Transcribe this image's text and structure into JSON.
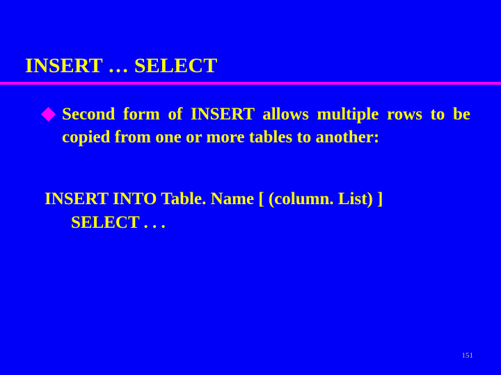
{
  "slide": {
    "title": "INSERT … SELECT",
    "bullet": "Second form of INSERT allows multiple rows to be copied from one or more tables to another:",
    "code": {
      "line1": "INSERT INTO Table. Name [ (column. List) ]",
      "line2": "SELECT . . ."
    },
    "page_number": "151"
  }
}
